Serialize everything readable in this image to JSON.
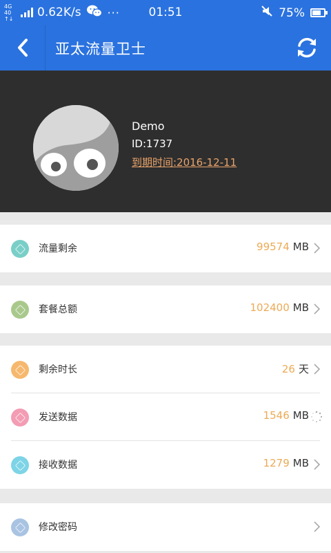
{
  "status_bar": {
    "network_tiny_top": "4G 40",
    "network_tiny_bottom": "↑↓",
    "speed": "0.62K/s",
    "wechat_icon": "wechat-icon",
    "more": "···",
    "time": "01:51",
    "battery": "75%",
    "battery_level": 0.75
  },
  "header": {
    "title": "亚太流量卫士",
    "back_icon": "chevron-left-icon",
    "refresh_icon": "refresh-icon",
    "color": "#2a72df"
  },
  "profile": {
    "name": "Demo",
    "id": "ID:1737",
    "expire": "到期时间:2016-12-11",
    "expire_color": "#e9a36a"
  },
  "rows": [
    {
      "label": "流量剩余",
      "value": "99574",
      "unit": "MB",
      "icon_color": "#79cfc8",
      "trailing": "chevron-right-icon"
    },
    {
      "label": "套餐总额",
      "value": "102400",
      "unit": "MB",
      "icon_color": "#a9c98c",
      "trailing": "chevron-right-icon"
    },
    {
      "label": "剩余时长",
      "value": "26",
      "unit": "天",
      "icon_color": "#f6b86e",
      "trailing": "chevron-right-icon"
    },
    {
      "label": "发送数据",
      "value": "1546",
      "unit": "MB",
      "icon_color": "#f39cb4",
      "trailing": "loading-spinner-icon"
    },
    {
      "label": "接收数据",
      "value": "1279",
      "unit": "MB",
      "icon_color": "#7dd4e6",
      "trailing": "chevron-right-icon"
    },
    {
      "label": "修改密码",
      "value": "",
      "unit": "",
      "icon_color": "#a9c3e2",
      "trailing": "chevron-right-icon"
    }
  ],
  "value_color": "#ecaa55"
}
